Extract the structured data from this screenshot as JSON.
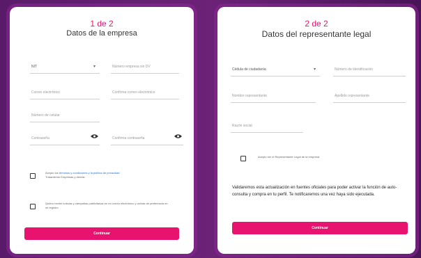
{
  "card1": {
    "step": "1 de 2",
    "title": "Datos de la empresa",
    "fields": {
      "type_value": "NIT",
      "number_placeholder": "Número empresa sin DV",
      "email_placeholder": "Correo electrónico",
      "confirm_email_placeholder": "Confirma correo electrónico",
      "cellphone_placeholder": "Número de celular",
      "password_placeholder": "Contraseña",
      "confirm_password_placeholder": "Confirma contraseña"
    },
    "checkbox1": {
      "prefix": "Acepto los",
      "link": "términos y condiciones y la política de privacidad",
      "suffix": "Tratamiento Empresas y demás"
    },
    "checkbox2": {
      "text": "Quiero recibir noticias y campañas publicitarias en mi correo electrónico y celular de preferencia en mi registro"
    },
    "button": "Continuar"
  },
  "card2": {
    "step": "2 de 2",
    "title": "Datos del representante legal",
    "fields": {
      "type_value": "Cédula de ciudadanía",
      "number_placeholder": "Número de identificación",
      "names_placeholder": "Nombre representante",
      "lastnames_placeholder": "Apellido representante",
      "email_placeholder": "Razón social"
    },
    "checkbox": {
      "text": "Acepto ser el Representante Legal de la empresa"
    },
    "note": "Validaremos esta actualización en fuentes oficiales para poder activar la función de auto-consulta y compra en tu perfil. Te notificaremos una vez haya sido ejecutada.",
    "button": "Continuar"
  },
  "colors": {
    "accent": "#e8136f",
    "frame": "#6b2277"
  },
  "icons": {
    "eye": "eye-icon",
    "caret": "caret-down-icon"
  }
}
